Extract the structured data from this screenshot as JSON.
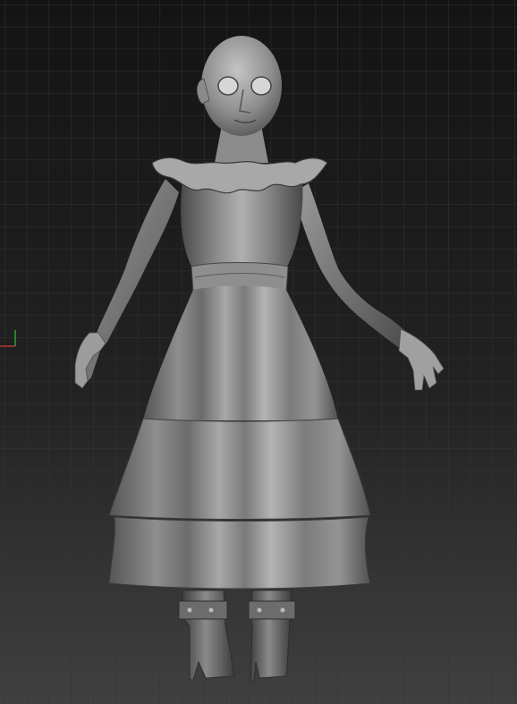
{
  "viewport": {
    "background_top": "#161616",
    "background_bottom": "#3e3e3e",
    "grid_color": "#2f2f2f"
  },
  "axis_gizmo": {
    "x_axis_color": "#c03030",
    "y_axis_color": "#30a030"
  },
  "model": {
    "material_color": "#8a8a8a",
    "highlight_color": "#d0d0d0",
    "shadow_color": "#3a3a3a"
  }
}
